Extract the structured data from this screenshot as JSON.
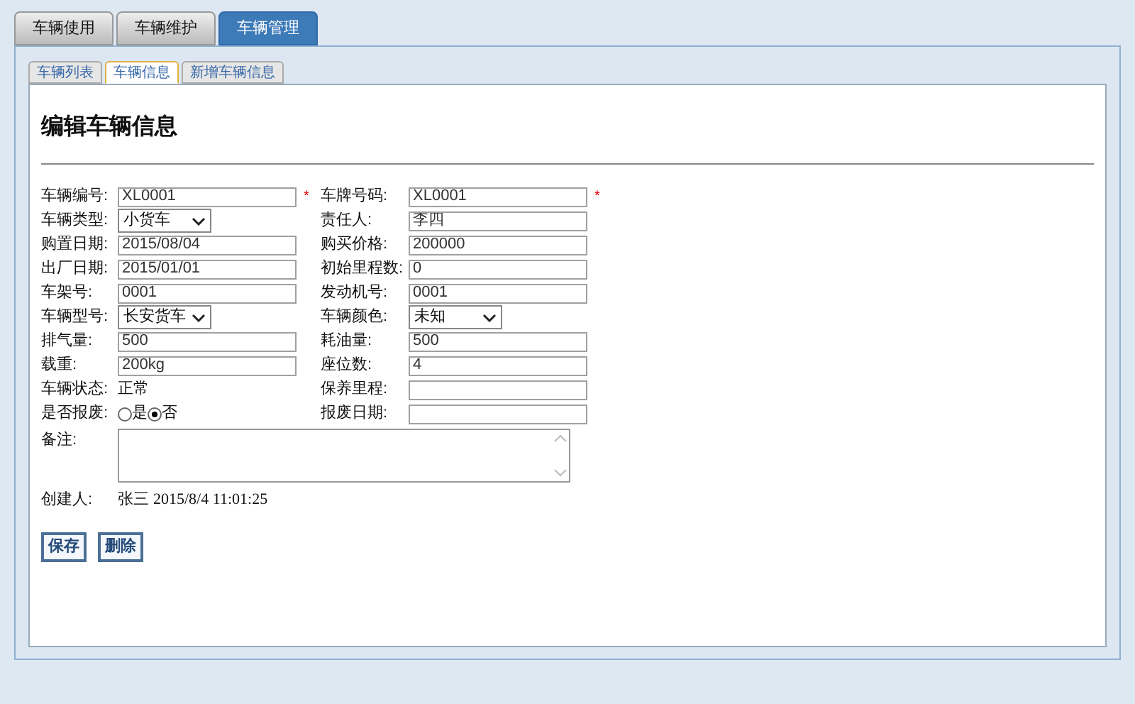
{
  "tabs": [
    {
      "label": "车辆使用",
      "selected": false
    },
    {
      "label": "车辆维护",
      "selected": false
    },
    {
      "label": "车辆管理",
      "selected": true
    }
  ],
  "subtabs": [
    {
      "label": "车辆列表",
      "selected": false
    },
    {
      "label": "车辆信息",
      "selected": true
    },
    {
      "label": "新增车辆信息",
      "selected": false
    }
  ],
  "heading": "编辑车辆信息",
  "rows": [
    [
      {
        "label": "车辆编号:",
        "kind": "text",
        "value": "XL0001",
        "required_mark": "*"
      },
      {
        "label": "车牌号码:",
        "kind": "text",
        "value": "XL0001",
        "required_mark": "*"
      }
    ],
    [
      {
        "label": "车辆类型:",
        "kind": "select",
        "value": "小货车"
      },
      {
        "label": "责任人:",
        "kind": "text",
        "value": "李四"
      }
    ],
    [
      {
        "label": "购置日期:",
        "kind": "text",
        "value": "2015/08/04"
      },
      {
        "label": "购买价格:",
        "kind": "text",
        "value": "200000"
      }
    ],
    [
      {
        "label": "出厂日期:",
        "kind": "text",
        "value": "2015/01/01"
      },
      {
        "label": "初始里程数:",
        "kind": "text",
        "value": "0"
      }
    ],
    [
      {
        "label": "车架号:",
        "kind": "text",
        "value": "0001"
      },
      {
        "label": "发动机号:",
        "kind": "text",
        "value": "0001"
      }
    ],
    [
      {
        "label": "车辆型号:",
        "kind": "select",
        "value": "长安货车"
      },
      {
        "label": "车辆颜色:",
        "kind": "select",
        "value": "未知"
      }
    ],
    [
      {
        "label": "排气量:",
        "kind": "text",
        "value": "500"
      },
      {
        "label": "耗油量:",
        "kind": "text",
        "value": "500"
      }
    ],
    [
      {
        "label": "载重:",
        "kind": "text",
        "value": "200kg"
      },
      {
        "label": "座位数:",
        "kind": "text",
        "value": "4"
      }
    ],
    [
      {
        "label": "车辆状态:",
        "kind": "static",
        "value": "正常"
      },
      {
        "label": "保养里程:",
        "kind": "text"
      }
    ],
    [
      {
        "label": "是否报废:",
        "kind": "radio",
        "options": [
          {
            "label": "是",
            "selected": false
          },
          {
            "label": "否",
            "selected": true
          }
        ]
      },
      {
        "label": "报废日期:",
        "kind": "text"
      }
    ]
  ],
  "remark": {
    "label": "备注:"
  },
  "creator": {
    "label": "创建人:",
    "name": "张三",
    "time": "2015/8/4 11:01:25"
  },
  "buttons": [
    "保存",
    "删除"
  ]
}
